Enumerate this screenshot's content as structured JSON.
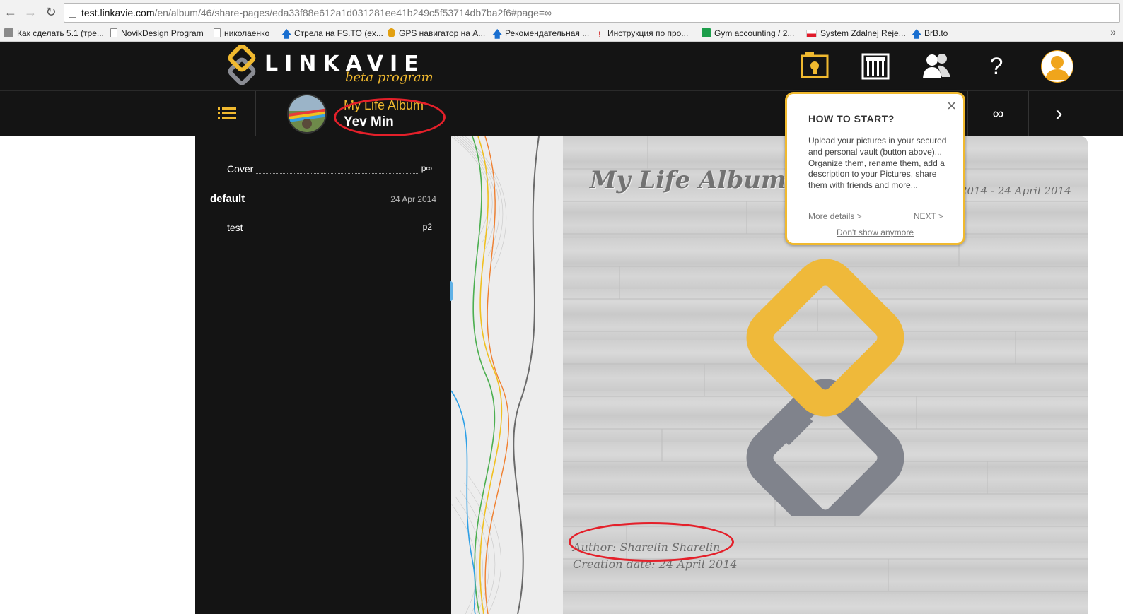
{
  "browser": {
    "back_icon": "arrow-left-icon",
    "forward_icon": "arrow-right-icon",
    "reload_icon": "reload-icon",
    "url_host": "test.linkavie.com",
    "url_path": "/en/album/46/share-pages/eda33f88e612a1d031281ee41b249c5f53714db7ba2f6#page=∞",
    "bookmarks": [
      {
        "label": "Как сделать 5.1 (тре...",
        "icon": "app-icon",
        "color": "#888888"
      },
      {
        "label": "NovikDesign Program",
        "icon": "page-icon",
        "color": "#ffffff"
      },
      {
        "label": "николаенко",
        "icon": "page-icon",
        "color": "#ffffff"
      },
      {
        "label": "Стрела на FS.TO (ex...",
        "icon": "arrow-up-icon",
        "color": "#1a6fd0"
      },
      {
        "label": "GPS навигатор на А...",
        "icon": "runner-icon",
        "color": "#e2a010"
      },
      {
        "label": "Рекомендательная ...",
        "icon": "arrow-up-icon",
        "color": "#1a6fd0"
      },
      {
        "label": "Инструкция по про...",
        "icon": "exclamation-icon",
        "color": "#d01818"
      },
      {
        "label": "Gym accounting / 2...",
        "icon": "spreadsheet-icon",
        "color": "#1d9e4b"
      },
      {
        "label": "System Zdalnej Reje...",
        "icon": "flag-icon",
        "color": "#e01a2a"
      },
      {
        "label": "BrB.to",
        "icon": "arrow-up-icon",
        "color": "#1a6fd0"
      }
    ],
    "bookmarks_more": "»"
  },
  "header": {
    "logo_text": "LINKAVIE",
    "logo_sub": "beta program",
    "nav_icons": [
      "vault-icon",
      "album-grid-icon",
      "friends-icon",
      "help-icon",
      "profile-icon"
    ],
    "help_label": "?"
  },
  "album": {
    "title": "My Life Album",
    "owner": "Yev Min",
    "page_indicator": "∞",
    "next_label": "›"
  },
  "toc": {
    "cover_label": "Cover",
    "cover_page": "p∞",
    "section_name": "default",
    "section_date": "24 Apr 2014",
    "test_label": "test",
    "test_page": "p2"
  },
  "cover": {
    "title": "My Life Album",
    "dates": "2014 - 24 April 2014",
    "author": "Author: Sharelin Sharelin",
    "creation_date": "Creation date: 24 April 2014"
  },
  "howto": {
    "heading": "HOW TO START?",
    "body": "Upload your pictures in your secured and personal vault (button above)... Organize them, rename them, add a description to your Pictures, share them with friends and more...",
    "more_details": "More details >",
    "next": "NEXT >",
    "dont_show": "Don't show anymore",
    "close": "×"
  },
  "colors": {
    "accent": "#f0b92f",
    "header_bg": "#141414",
    "annotation": "#e4202a",
    "logo_gray": "#8a8c93"
  }
}
